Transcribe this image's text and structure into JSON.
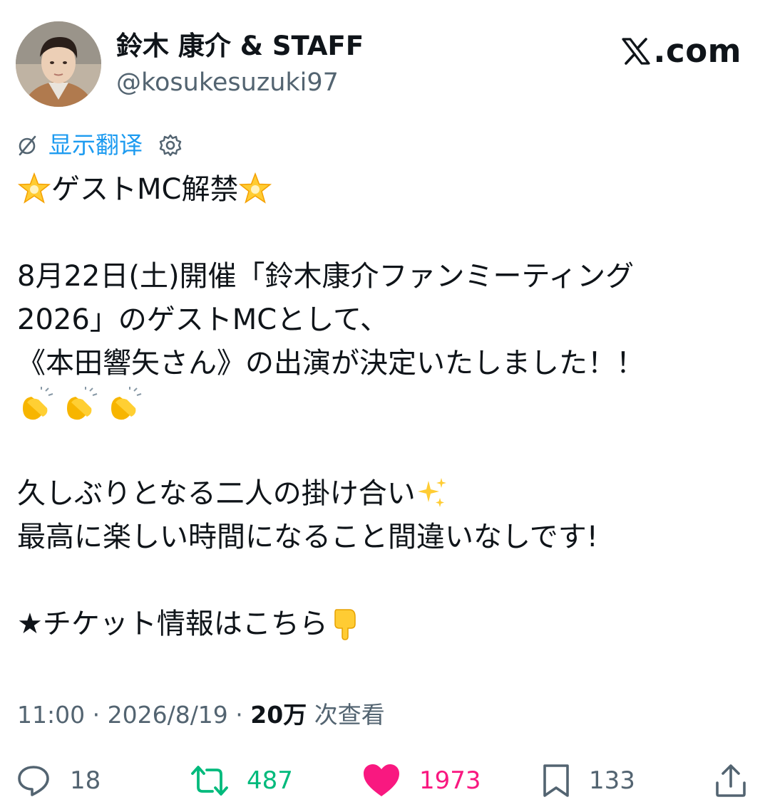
{
  "author": {
    "display_name": "鈴木 康介 & STAFF",
    "handle": "@kosukesuzuki97",
    "avatar_icon": "profile-photo"
  },
  "brand": {
    "text": "X.com",
    "rest": ".com",
    "logo_icon": "x-logo"
  },
  "translate": {
    "label": "显示翻译",
    "icon": "translate-icon",
    "settings_icon": "gear-icon"
  },
  "tweet": {
    "line1": "ゲストMC解禁",
    "line2": "8月22日(土)開催「鈴木康介ファンミーティング",
    "line3": "2026」のゲストMCとして、",
    "line4": "《本田響矢さん》の出演が決定いたしました！！",
    "line6": "久しぶりとなる二人の掛け合い",
    "line7": "最高に楽しい時間になること間違いなしです!",
    "line8": "★チケット情報はこちら"
  },
  "meta": {
    "time": "11:00",
    "sep1": " · ",
    "date": "2026/8/19",
    "sep2": " · ",
    "views_count": "20万",
    "views_label": " 次查看"
  },
  "actions": {
    "replies": "18",
    "retweets": "487",
    "likes": "1973",
    "bookmarks": "133",
    "colors": {
      "retweet": "#00ba7c",
      "like": "#f91880",
      "default": "#536471"
    }
  }
}
